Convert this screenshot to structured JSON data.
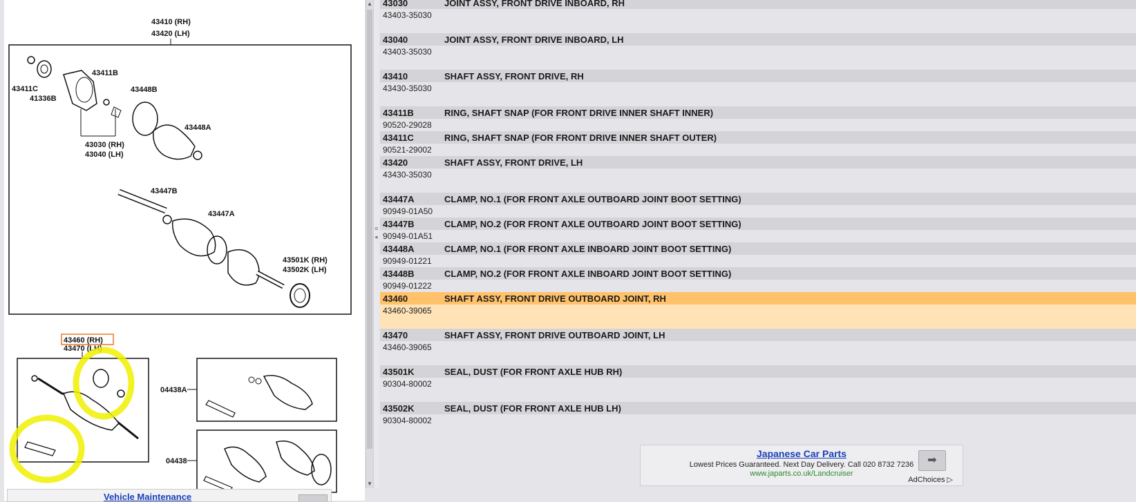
{
  "diagram": {
    "labels": {
      "top_rh": "43410 (RH)",
      "top_lh": "43420 (LH)",
      "l43411c": "43411C",
      "l41336b": "41336B",
      "l43411b": "43411B",
      "l43448b": "43448B",
      "l43448a": "43448A",
      "l43030": "43030 (RH)",
      "l43040": "43040 (LH)",
      "l43447b": "43447B",
      "l43447a": "43447A",
      "l43501k": "43501K (RH)",
      "l43502k": "43502K (LH)",
      "l43460": "43460 (RH)",
      "l43470": "43470 (LH)",
      "l04438a": "04438A",
      "l04438": "04438"
    },
    "highlight_color": "#f0f000",
    "selection_box_color": "#e8782a"
  },
  "parts": [
    {
      "num": "43030",
      "desc": "JOINT ASSY, FRONT DRIVE INBOARD, RH",
      "pn": "43403-35030"
    },
    {
      "num": "43040",
      "desc": "JOINT ASSY, FRONT DRIVE INBOARD, LH",
      "pn": "43403-35030"
    },
    {
      "num": "43410",
      "desc": "SHAFT ASSY, FRONT DRIVE, RH",
      "pn": "43430-35030"
    },
    {
      "num": "43411B",
      "desc": "RING, SHAFT SNAP (FOR FRONT DRIVE INNER SHAFT INNER)",
      "pn": "90520-29028"
    },
    {
      "num": "43411C",
      "desc": "RING, SHAFT SNAP (FOR FRONT DRIVE INNER SHAFT OUTER)",
      "pn": "90521-29002"
    },
    {
      "num": "43420",
      "desc": "SHAFT ASSY, FRONT DRIVE, LH",
      "pn": "43430-35030"
    },
    {
      "num": "43447A",
      "desc": "CLAMP, NO.1 (FOR FRONT AXLE OUTBOARD JOINT BOOT SETTING)",
      "pn": "90949-01A50"
    },
    {
      "num": "43447B",
      "desc": "CLAMP, NO.2 (FOR FRONT AXLE OUTBOARD JOINT BOOT SETTING)",
      "pn": "90949-01A51"
    },
    {
      "num": "43448A",
      "desc": "CLAMP, NO.1 (FOR FRONT AXLE INBOARD JOINT BOOT SETTING)",
      "pn": "90949-01221"
    },
    {
      "num": "43448B",
      "desc": "CLAMP, NO.2 (FOR FRONT AXLE INBOARD JOINT BOOT SETTING)",
      "pn": "90949-01222"
    },
    {
      "num": "43460",
      "desc": "SHAFT ASSY, FRONT DRIVE OUTBOARD JOINT, RH",
      "pn": "43460-39065",
      "selected": true
    },
    {
      "num": "43470",
      "desc": "SHAFT ASSY, FRONT DRIVE OUTBOARD JOINT, LH",
      "pn": "43460-39065"
    },
    {
      "num": "43501K",
      "desc": "SEAL, DUST (FOR FRONT AXLE HUB RH)",
      "pn": "90304-80002"
    },
    {
      "num": "43502K",
      "desc": "SEAL, DUST (FOR FRONT AXLE HUB LH)",
      "pn": "90304-80002"
    }
  ],
  "ad": {
    "title": "Japanese Car Parts",
    "subtitle": "Lowest Prices Guaranteed. Next Day Delivery. Call 020 8732 7236",
    "url": "www.japarts.co.uk/Landcruiser",
    "go_icon": "arrow-right-icon",
    "choices": "AdChoices"
  },
  "bottom": {
    "link": "Vehicle Maintenance"
  },
  "colors": {
    "row_header": "#d4d4d8",
    "row_selected": "#ffc26a",
    "row_selected_sub": "#ffe3b6"
  }
}
